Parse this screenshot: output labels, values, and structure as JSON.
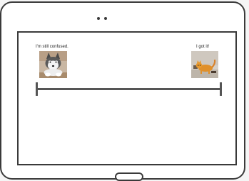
{
  "left_caption": "I'm still confused.",
  "right_caption": "I got it!",
  "left_image": {
    "icon": "husky-puppy-photo"
  },
  "right_image": {
    "icon": "orange-cat-photo"
  },
  "colors": {
    "frame": "#3a3a3a",
    "scale": "#555555",
    "background": "#ffffff"
  }
}
